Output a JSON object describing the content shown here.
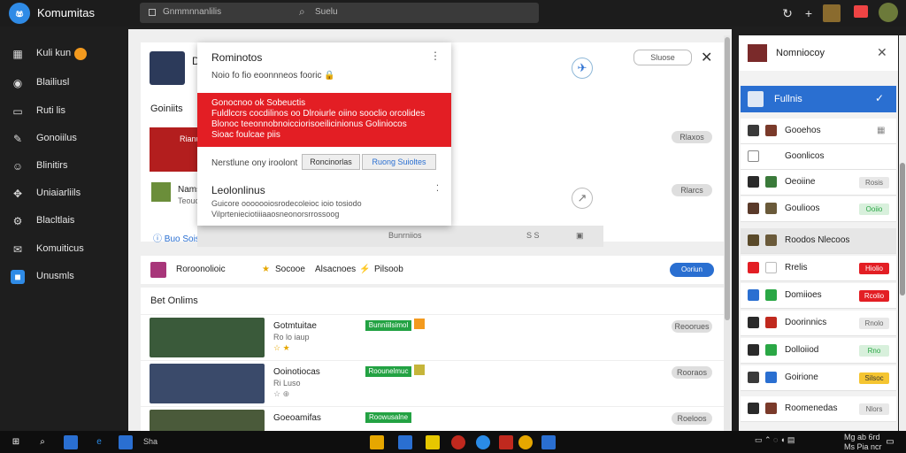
{
  "app": {
    "title": "Komumitas",
    "logo_glyph": "ෂ"
  },
  "search": {
    "address": "Gnmmnnanlilis",
    "placeholder": "Suelu"
  },
  "topbar_icons": [
    "refresh-icon",
    "plus-icon",
    "game-avatar",
    "notification-icon",
    "user-avatar"
  ],
  "sidebar": {
    "items": [
      {
        "label": "Kuli kun",
        "icon": "grid-icon",
        "badge": true
      },
      {
        "label": "Blailiusl",
        "icon": "disc-icon"
      },
      {
        "label": "Ruti lis",
        "icon": "bookmark-icon"
      },
      {
        "label": "Gonoiilus",
        "icon": "tag-icon"
      },
      {
        "label": "Blinitirs",
        "icon": "smile-icon"
      },
      {
        "label": "Uniaiarliils",
        "icon": "puzzle-icon"
      },
      {
        "label": "Blacltlais",
        "icon": "gear-icon"
      },
      {
        "label": "Komuiticus",
        "icon": "mail-icon"
      },
      {
        "label": "Unusmls",
        "icon": "app-icon"
      }
    ]
  },
  "main": {
    "header_letter": "D",
    "follow_button": "Sluose",
    "section_label": "Goiniits",
    "games": [
      {
        "name": "Rianuic",
        "pill": "Rlaxos"
      },
      {
        "name": "Namsi",
        "sub": "Teouci",
        "pill": "Rlarcs"
      }
    ],
    "show_more": "Buo Sois",
    "strip_text": "Bunrniios",
    "strip_icons": "S S"
  },
  "popup": {
    "title": "Rominotos",
    "subtitle": "Noio fo fio eoonnneos fooric",
    "alert_lines": [
      "Gonocnoo ok Sobeuctis",
      "Fuldlccrs cocdilinos oo Dlroiurle oiino sooclio orcolides",
      "Blonoc teeonnobnoicciorisoeilicinionus Goliniocos",
      "Sioac foulcae piis"
    ],
    "row_label": "Nerstlune ony iroolont",
    "btn1": "Roncinorlas",
    "btn2": "Ruong Suioltes",
    "section_title": "Leolonlinus",
    "desc": "Guicore ooooooiosrodecoleioc ioio tosiodo Vilprtenieciotiiiaaosneonorsrrossoog"
  },
  "friends": {
    "label": "Roroonolioic",
    "item2": "Socooe",
    "item3": "Alsacnoes",
    "item4": "Pilsoob",
    "button": "Ooriun"
  },
  "online": {
    "title": "Bet Onlims",
    "rows": [
      {
        "name": "Gotmtuitae",
        "sub": "Ro lo iaup",
        "tag": "Bunniiilsimol",
        "pill": "Reoorues"
      },
      {
        "name": "Ooinotiocas",
        "sub": "Ri Luso",
        "tag": "Roounelmuc",
        "pill": "Rooraos"
      },
      {
        "name": "Goeoamifas",
        "sub": "",
        "tag": "Roowusalne",
        "pill": "Roeloos"
      }
    ]
  },
  "right_panel": {
    "header": "Nomniocoy",
    "selected": "Fullnis",
    "items": [
      {
        "label": "Gooehos",
        "tag": "",
        "tag_color": ""
      },
      {
        "label": "Goonlicos",
        "tag": "",
        "tag_color": ""
      },
      {
        "label": "Oeoiine",
        "tag": "Rosis",
        "tag_color": "#e8e8e8"
      },
      {
        "label": "Goulioos",
        "tag": "Ooiio",
        "tag_color": "#2aa745"
      },
      {
        "label": "Roodos Nlecoos",
        "tag": "",
        "tag_color": ""
      },
      {
        "label": "Rrelis",
        "tag": "Hiolio",
        "tag_color": "#e31e24"
      },
      {
        "label": "Domiioes",
        "tag": "Rcolio",
        "tag_color": "#e31e24"
      },
      {
        "label": "Doorinnics",
        "tag": "Rnolo",
        "tag_color": "#e8e8e8"
      },
      {
        "label": "Dolloiiod",
        "tag": "Rno",
        "tag_color": "#2aa745"
      },
      {
        "label": "Goirione",
        "tag": "Silsoc",
        "tag_color": "#f5c531"
      },
      {
        "label": "Roomenedas",
        "tag": "Nlors",
        "tag_color": "#e8e8e8"
      }
    ]
  },
  "taskbar": {
    "search_text": "Sha",
    "tray_text": "Mg ab 6rd",
    "tray_date": "Ms Pia ncr"
  }
}
